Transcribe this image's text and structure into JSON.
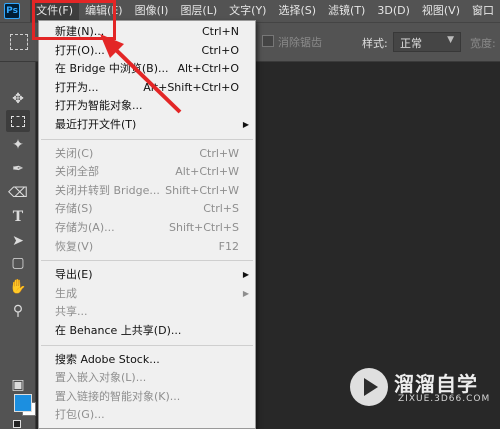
{
  "app": {
    "logo_text": "Ps"
  },
  "menubar": {
    "items": [
      "文件(F)",
      "编辑(E)",
      "图像(I)",
      "图层(L)",
      "文字(Y)",
      "选择(S)",
      "滤镜(T)",
      "3D(D)",
      "视图(V)",
      "窗口"
    ],
    "active_index": 0
  },
  "options_bar": {
    "antialias_label": "消除锯齿",
    "style_label": "样式:",
    "style_value": "正常",
    "width_label": "宽度:"
  },
  "file_menu": {
    "items": [
      {
        "label": "新建(N)...",
        "shortcut": "Ctrl+N",
        "enabled": true
      },
      {
        "label": "打开(O)...",
        "shortcut": "Ctrl+O",
        "enabled": true
      },
      {
        "label": "在 Bridge 中浏览(B)...",
        "shortcut": "Alt+Ctrl+O",
        "enabled": true
      },
      {
        "label": "打开为...",
        "shortcut": "Alt+Shift+Ctrl+O",
        "enabled": true
      },
      {
        "label": "打开为智能对象...",
        "shortcut": "",
        "enabled": true
      },
      {
        "label": "最近打开文件(T)",
        "shortcut": "",
        "enabled": true,
        "submenu": true
      },
      {
        "separator": true
      },
      {
        "label": "关闭(C)",
        "shortcut": "Ctrl+W",
        "enabled": false
      },
      {
        "label": "关闭全部",
        "shortcut": "Alt+Ctrl+W",
        "enabled": false
      },
      {
        "label": "关闭并转到 Bridge...",
        "shortcut": "Shift+Ctrl+W",
        "enabled": false
      },
      {
        "label": "存储(S)",
        "shortcut": "Ctrl+S",
        "enabled": false
      },
      {
        "label": "存储为(A)...",
        "shortcut": "Shift+Ctrl+S",
        "enabled": false
      },
      {
        "label": "恢复(V)",
        "shortcut": "F12",
        "enabled": false
      },
      {
        "separator": true
      },
      {
        "label": "导出(E)",
        "shortcut": "",
        "enabled": true,
        "submenu": true
      },
      {
        "label": "生成",
        "shortcut": "",
        "enabled": false,
        "submenu": true
      },
      {
        "label": "共享...",
        "shortcut": "",
        "enabled": false
      },
      {
        "label": "在 Behance 上共享(D)...",
        "shortcut": "",
        "enabled": true
      },
      {
        "separator": true
      },
      {
        "label": "搜索 Adobe Stock...",
        "shortcut": "",
        "enabled": true
      },
      {
        "label": "置入嵌入对象(L)...",
        "shortcut": "",
        "enabled": false
      },
      {
        "label": "置入链接的智能对象(K)...",
        "shortcut": "",
        "enabled": false
      },
      {
        "label": "打包(G)...",
        "shortcut": "",
        "enabled": false
      }
    ]
  },
  "watermark": {
    "title": "溜溜自学",
    "url": "ZIXUE.3D66.COM"
  },
  "colors": {
    "foreground": "#1c8fe0",
    "background": "#ffffff",
    "annotation": "#e32626"
  }
}
